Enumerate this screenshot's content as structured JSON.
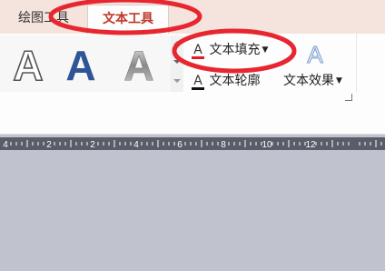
{
  "tabs": {
    "drawing_tools": "绘图工具",
    "text_tools": "文本工具"
  },
  "ribbon": {
    "gallery": [
      {
        "glyph": "A",
        "style": "outline"
      },
      {
        "glyph": "A",
        "style": "blue"
      },
      {
        "glyph": "A",
        "style": "gradient"
      }
    ],
    "text_fill": "文本填充",
    "text_outline": "文本轮廓",
    "text_effect": "文本效果",
    "effect_glyph": "A",
    "fill_glyph": "A",
    "outline_glyph": "A",
    "dropdown_glyph": "▼"
  },
  "ruler": {
    "labels": [
      "4",
      "2",
      "2",
      "4",
      "6",
      "8",
      "10",
      "12"
    ]
  },
  "colors": {
    "annotation": "#e8262f",
    "text_tab": "#c0392b",
    "fill_bar": "#e02020",
    "outline_bar": "#111111",
    "gallery_blue": "#2f5597"
  }
}
